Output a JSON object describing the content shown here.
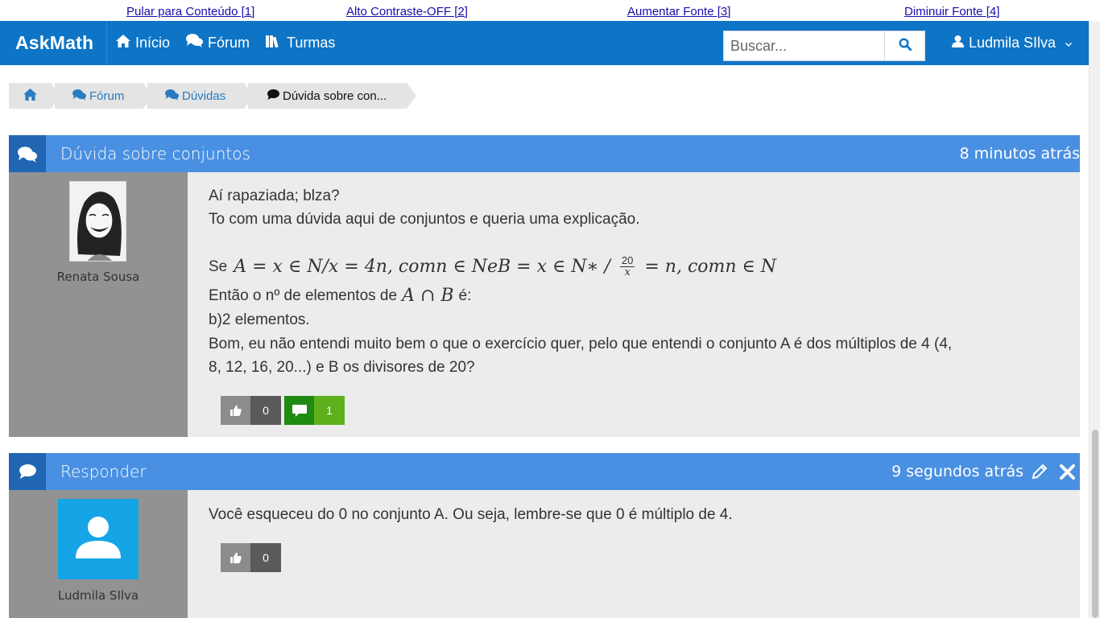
{
  "access_bar": {
    "skip": "Pular para Conteúdo [1]",
    "contrast": "Alto Contraste-OFF [2]",
    "increase": "Aumentar Fonte [3]",
    "decrease": "Diminuir Fonte [4]"
  },
  "navbar": {
    "brand": "AskMath",
    "items": [
      {
        "label": "Início",
        "icon": "home-icon"
      },
      {
        "label": "Fórum",
        "icon": "comments-icon"
      },
      {
        "label": "Turmas",
        "icon": "library-icon"
      }
    ],
    "search_placeholder": "Buscar...",
    "user": "Ludmila SIlva"
  },
  "breadcrumb": {
    "items": [
      "Fórum",
      "Dúvidas",
      "Dúvida sobre con..."
    ]
  },
  "question": {
    "title": "Dúvida sobre conjuntos",
    "time": "8 minutos atrás",
    "author": "Renata Sousa",
    "line1": "Aí rapaziada; blza?",
    "line2": "To com uma dúvida aqui de conjuntos e queria uma explicação.",
    "math_prefix": "Se",
    "math_part1": "A = x ∈ N/x = 4n, comn ∈ NeB = x ∈ N∗ /",
    "math_frac_num": "20",
    "math_frac_den": "x",
    "math_part2": "= n, comn ∈ N",
    "line4_prefix": "Então o nº de elementos de",
    "line4_math": "A ∩ B",
    "line4_suffix": "é:",
    "line5": "b)2 elementos.",
    "line6": "Bom, eu não entendi muito bem o que o exercício quer, pelo que entendi o conjunto A é dos múltiplos de 4 (4,",
    "line7": "8, 12, 16, 20...) e B os divisores de 20?",
    "likes": "0",
    "replies": "1"
  },
  "answer": {
    "title": "Responder",
    "time": "9 segundos atrás",
    "author": "Ludmila SIlva",
    "text": "Você esqueceu do 0 no conjunto A. Ou seja, lembre-se que 0 é múltiplo de 4.",
    "likes": "0"
  },
  "colors": {
    "navbar": "#0d74c6",
    "post_header": "#4a90e2",
    "header_icon": "#2166b3",
    "reply_green": "#1f8b13"
  }
}
